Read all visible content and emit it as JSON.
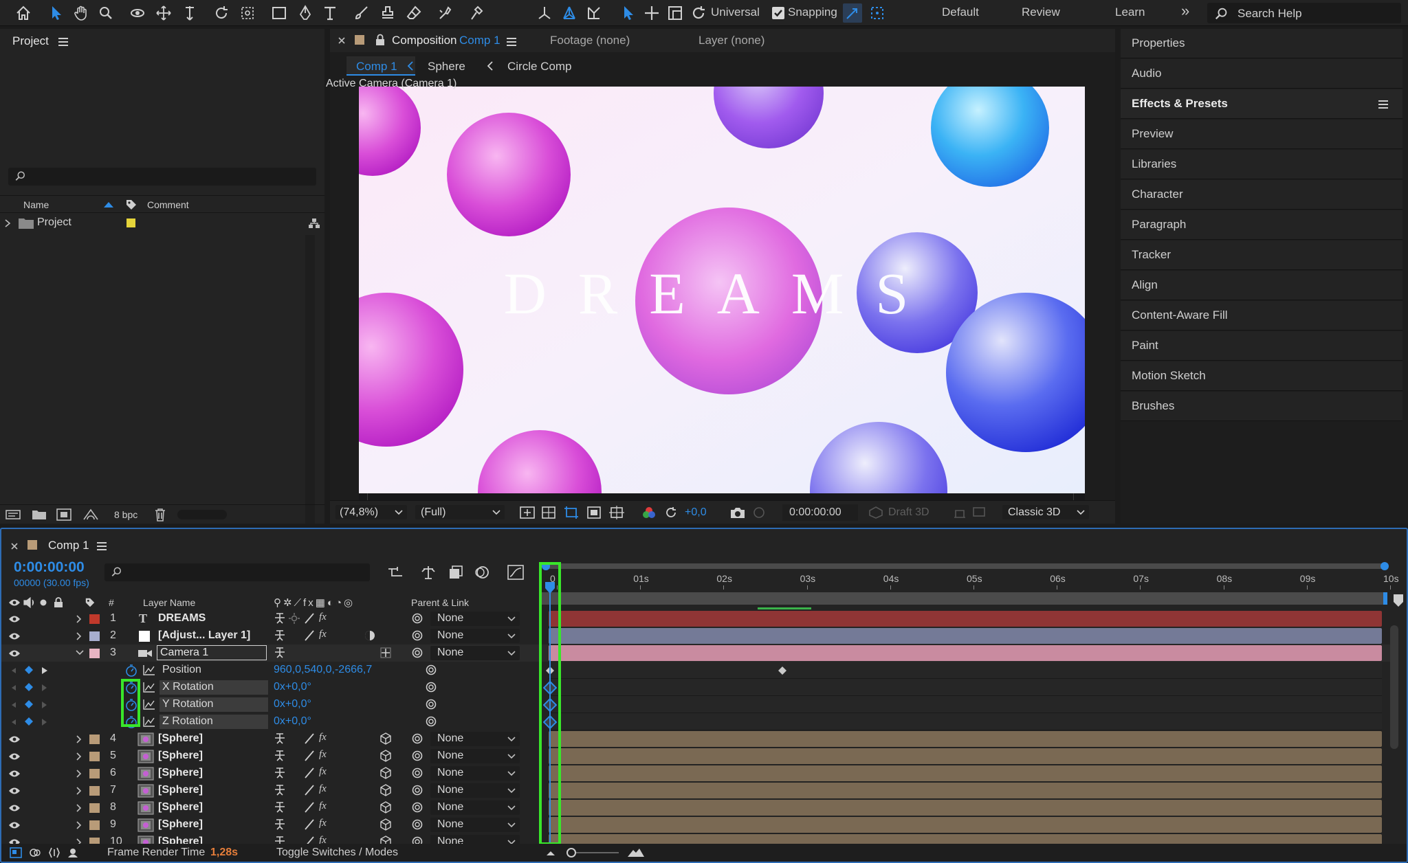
{
  "toolbar": {
    "universal_label": "Universal",
    "snapping_label": "Snapping",
    "workspaces": [
      "Default",
      "Review",
      "Learn"
    ],
    "more": "»",
    "search_placeholder": "Search Help"
  },
  "project": {
    "title": "Project",
    "col_name": "Name",
    "col_comment": "Comment",
    "item_label": "Project",
    "bpc": "8 bpc"
  },
  "viewer": {
    "comp_tab_prefix": "Composition",
    "comp_tab_name": "Comp 1",
    "footage_tab": "Footage (none)",
    "layer_tab": "Layer (none)",
    "breadcrumbs": [
      "Comp 1",
      "Sphere",
      "Circle Comp"
    ],
    "active_camera": "Active Camera (Camera 1)",
    "canvas_text": "DREAMS",
    "zoom": "(74,8%)",
    "resolution": "(Full)",
    "exposure": "+0,0",
    "timecode": "0:00:00:00",
    "draft3d": "Draft 3D",
    "renderer": "Classic 3D"
  },
  "right_panel": {
    "items": [
      "Properties",
      "Audio",
      "Effects & Presets",
      "Preview",
      "Libraries",
      "Character",
      "Paragraph",
      "Tracker",
      "Align",
      "Content-Aware Fill",
      "Paint",
      "Motion Sketch",
      "Brushes"
    ]
  },
  "timeline": {
    "tab": "Comp 1",
    "timecode": "0:00:00:00",
    "frame_info": "00000 (30.00 fps)",
    "col_number": "#",
    "col_layer_name": "Layer Name",
    "col_parent": "Parent & Link",
    "ruler": [
      "0",
      "01s",
      "02s",
      "03s",
      "04s",
      "05s",
      "06s",
      "07s",
      "08s",
      "09s",
      "10s"
    ],
    "layers": [
      {
        "num": "1",
        "name": "DREAMS",
        "type": "T",
        "color": "#c0392b",
        "parent": "None"
      },
      {
        "num": "2",
        "name": "[Adjust... Layer 1]",
        "type": "adj",
        "color": "#a7aecf",
        "parent": "None"
      },
      {
        "num": "3",
        "name": "Camera 1",
        "type": "cam",
        "color": "#e8b4c3",
        "parent": "None"
      }
    ],
    "properties": [
      {
        "name": "Position",
        "value": "960,0,540,0,-2666,7"
      },
      {
        "name": "X Rotation",
        "value": "0x+0,0°"
      },
      {
        "name": "Y Rotation",
        "value": "0x+0,0°"
      },
      {
        "name": "Z Rotation",
        "value": "0x+0,0°"
      }
    ],
    "sphere_layers": [
      {
        "num": "4",
        "name": "[Sphere]",
        "parent": "None"
      },
      {
        "num": "5",
        "name": "[Sphere]",
        "parent": "None"
      },
      {
        "num": "6",
        "name": "[Sphere]",
        "parent": "None"
      },
      {
        "num": "7",
        "name": "[Sphere]",
        "parent": "None"
      },
      {
        "num": "8",
        "name": "[Sphere]",
        "parent": "None"
      },
      {
        "num": "9",
        "name": "[Sphere]",
        "parent": "None"
      },
      {
        "num": "10",
        "name": "[Sphere]",
        "parent": "None"
      }
    ],
    "footer_label": "Frame Render Time",
    "footer_value": "1,28s",
    "toggle_label": "Toggle Switches / Modes"
  },
  "colors": {
    "accent_blue": "#2e8ce6",
    "highlight_green": "#39e62a",
    "sphere_color": "#b89b78",
    "bar_red": "#8f3535",
    "bar_lavender": "#747a97",
    "bar_pink": "#c98ba0",
    "bar_tan": "#7a6953",
    "label_sphere": "#c9a57a"
  }
}
